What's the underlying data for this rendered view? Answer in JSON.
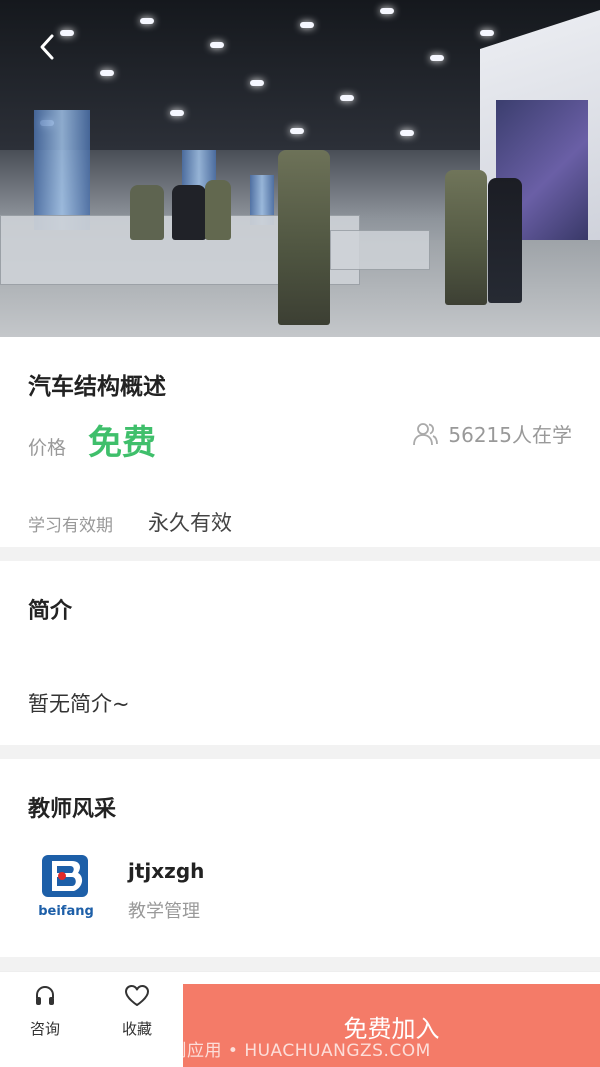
{
  "nav": {
    "back_icon": "chevron-left-icon"
  },
  "course": {
    "title": "汽车结构概述",
    "price_label": "价格",
    "price_value": "免费",
    "learners_icon": "users-icon",
    "learners_text": "56215人在学",
    "validity_label": "学习有效期",
    "validity_value": "永久有效"
  },
  "intro": {
    "title": "简介",
    "text": "暂无简介~"
  },
  "teacher": {
    "title": "教师风采",
    "logo_text": "beifang",
    "name": "jtjxzgh",
    "role": "教学管理"
  },
  "bottom_bar": {
    "consult_label": "咨询",
    "favorite_label": "收藏",
    "join_label": "免费加入"
  },
  "watermark": "华创应用 • HUACHUANGZS.COM",
  "colors": {
    "price_green": "#3fbf6b",
    "join_button": "#f47b68",
    "logo_blue": "#1d5fa8",
    "logo_red": "#e02a2a"
  }
}
